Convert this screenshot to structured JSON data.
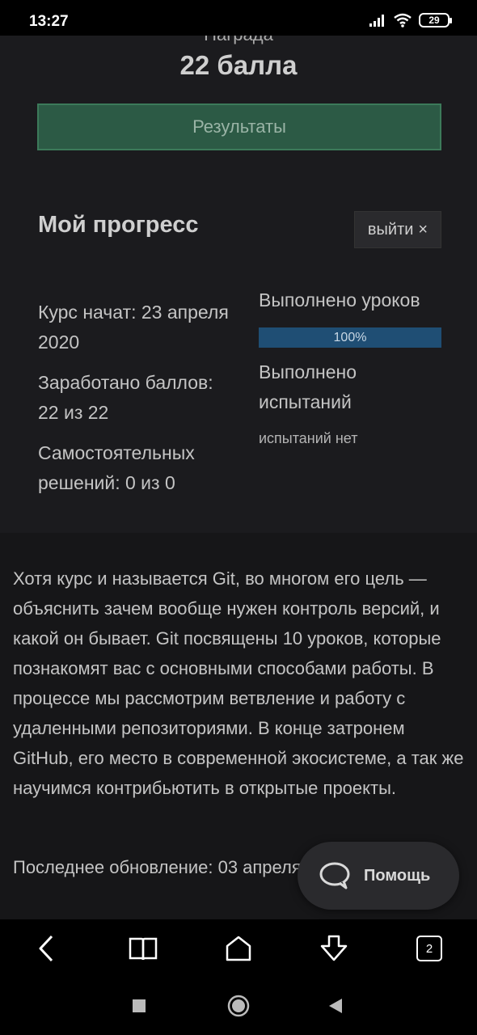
{
  "status": {
    "time": "13:27",
    "battery": "29"
  },
  "card": {
    "clipped_text": "Награда",
    "score": "22 балла",
    "results_button": "Результаты",
    "progress_title": "Мой прогресс",
    "logout_button": "выйти",
    "logout_icon": "×",
    "course_started": "Курс начат: 23 апреля 2020",
    "points_earned": "Заработано баллов: 22 из 22",
    "self_solutions": "Самостоятельных решений: 0 из 0",
    "lessons_label": "Выполнено уроков",
    "lessons_progress_text": "100%",
    "lessons_progress": 1.0,
    "trials_label": "Выполнено испытаний",
    "trials_none": "испытаний нет"
  },
  "description": "Хотя курс и называется Git, во многом его цель — объяснить зачем вообще нужен контроль версий, и какой он бывает. Git посвящены 10 уроков, которые познакомят вас с основными способами работы. В процессе мы рассмотрим ветвление и работу с удаленными репозиториями. В конце затронем GitHub, его место в современной экосистеме, а так же научимся контрибьютить в открытые проекты.",
  "last_update": "Последнее обновление: 03 апреля",
  "help_button": "Помощь",
  "browser_nav": {
    "tabs_count": "2"
  },
  "colors": {
    "accent_green": "#2c5a45",
    "progress_blue": "#1f4e74",
    "background": "#161618"
  }
}
